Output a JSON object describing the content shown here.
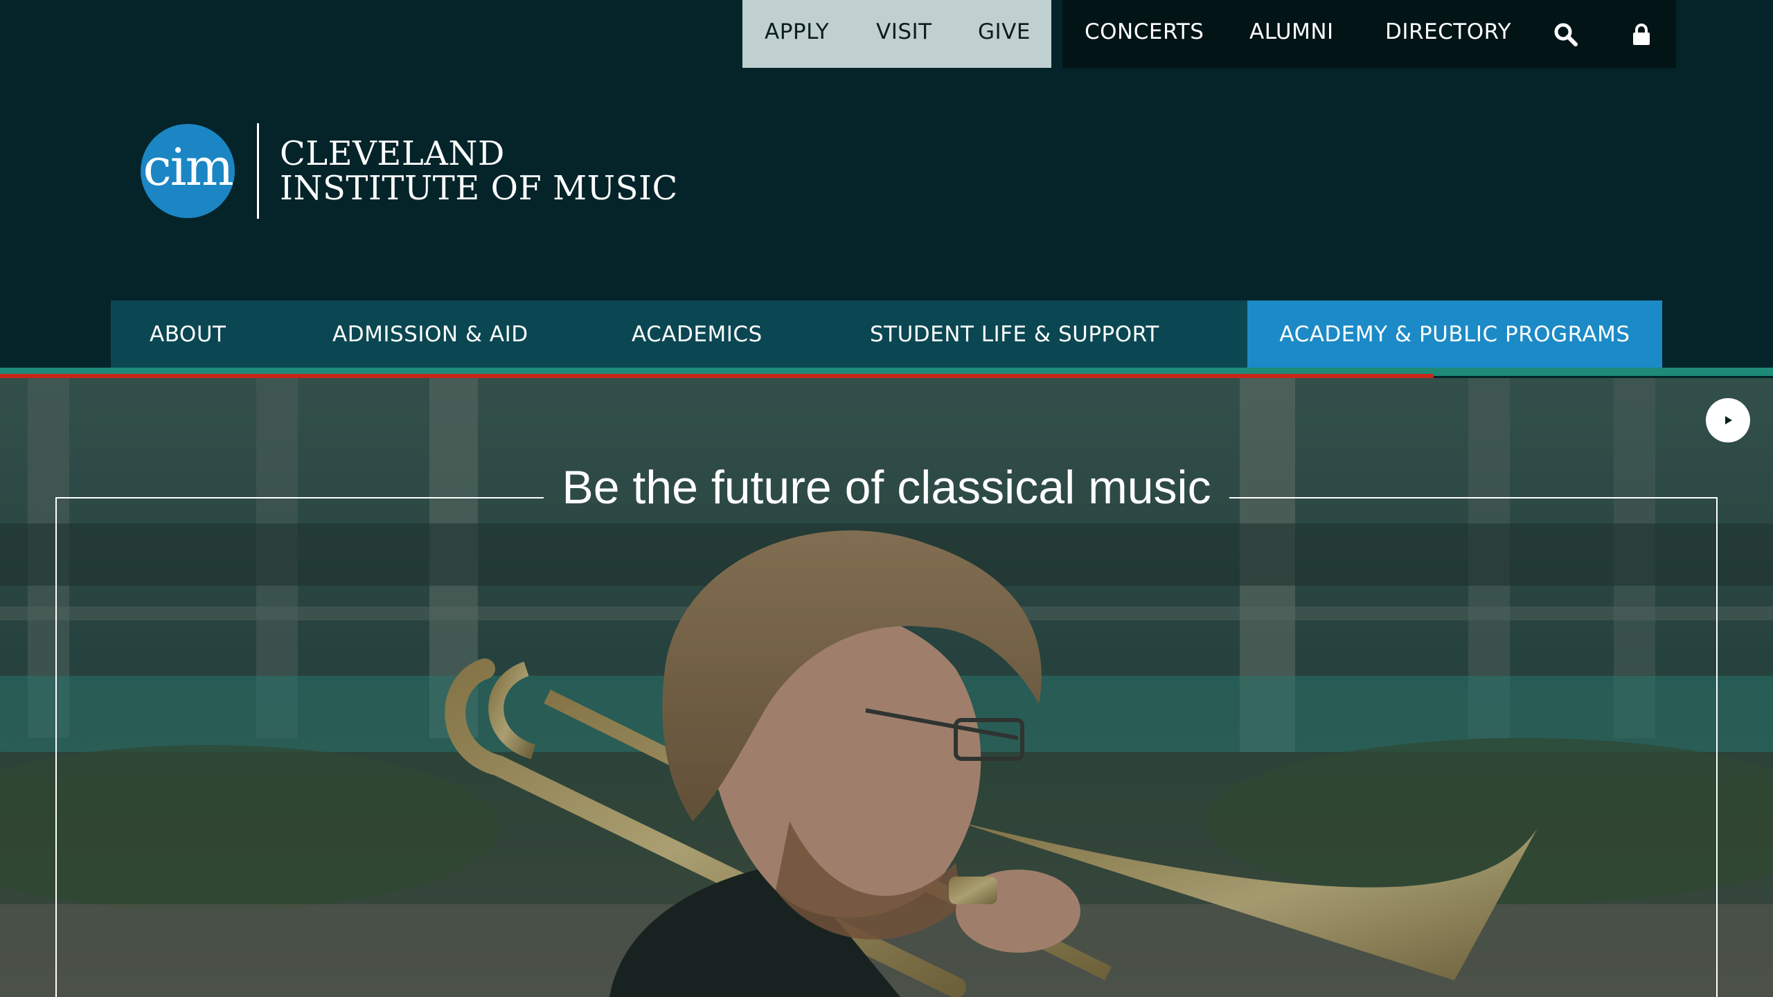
{
  "utility_nav": {
    "primary": [
      {
        "label": "APPLY"
      },
      {
        "label": "VISIT"
      },
      {
        "label": "GIVE"
      }
    ],
    "secondary": [
      {
        "label": "CONCERTS"
      },
      {
        "label": "ALUMNI"
      },
      {
        "label": "DIRECTORY"
      }
    ],
    "icons": [
      "search-icon",
      "lock-icon"
    ]
  },
  "logo": {
    "mark": "cim",
    "line1": "CLEVELAND",
    "line2": "INSTITUTE OF MUSIC"
  },
  "main_nav": {
    "items": [
      {
        "label": "ABOUT"
      },
      {
        "label": "ADMISSION & AID"
      },
      {
        "label": "ACADEMICS"
      },
      {
        "label": "STUDENT LIFE & SUPPORT"
      },
      {
        "label": "ACADEMY & PUBLIC PROGRAMS"
      }
    ],
    "active_index": 4
  },
  "hero": {
    "headline": "Be the future of classical music",
    "play_icon": "play-icon"
  },
  "colors": {
    "header_bg": "#04242a",
    "nav_bg": "#0b4752",
    "nav_active": "#1c8ac7",
    "utility_light": "#c0cfcf",
    "utility_dark": "#031416",
    "accent_teal": "#1e8a78",
    "accent_red": "#c8261a",
    "logo_blue": "#1b86c3"
  }
}
